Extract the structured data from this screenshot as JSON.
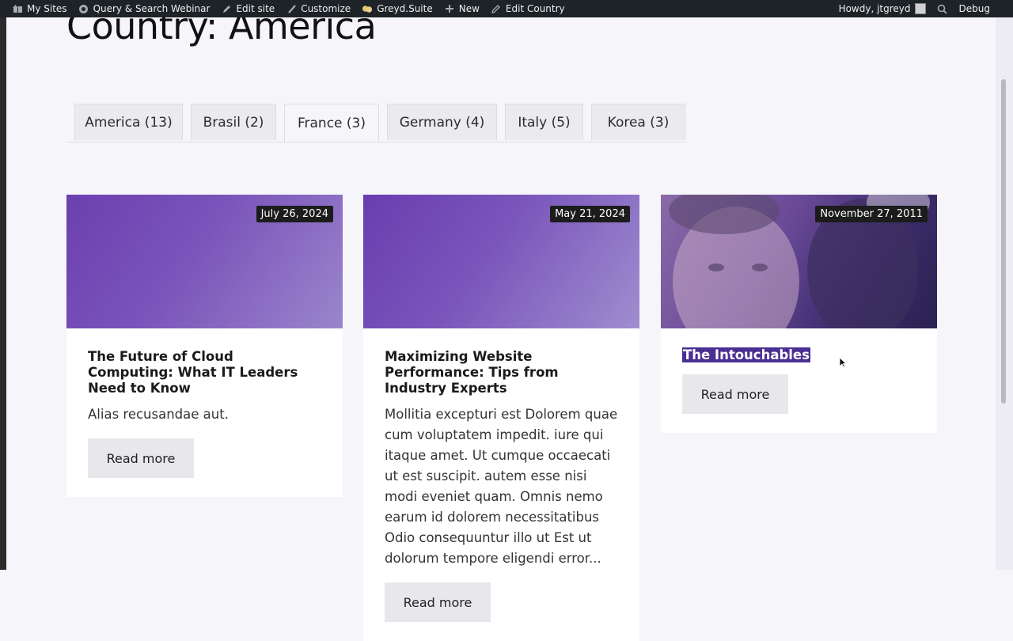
{
  "adminbar": {
    "left": [
      {
        "label": "My Sites",
        "icon": "my-sites-icon"
      },
      {
        "label": "Query & Search Webinar",
        "icon": "site-home-icon"
      },
      {
        "label": "Edit site",
        "icon": "edit-site-icon"
      },
      {
        "label": "Customize",
        "icon": "customize-brush-icon"
      },
      {
        "label": "Greyd.Suite",
        "icon": "greyd-icon"
      },
      {
        "label": "New",
        "icon": "plus-icon"
      },
      {
        "label": "Edit Country",
        "icon": "pencil-icon"
      }
    ],
    "howdy": "Howdy, jtgreyd",
    "debug": "Debug"
  },
  "page": {
    "title": "Country: America"
  },
  "tabs": [
    {
      "label": "America (13)"
    },
    {
      "label": "Brasil (2)"
    },
    {
      "label": "France (3)"
    },
    {
      "label": "Germany (4)"
    },
    {
      "label": "Italy (5)"
    },
    {
      "label": "Korea (3)"
    }
  ],
  "active_tab": "France (3)",
  "cards": [
    {
      "date": "July 26, 2024",
      "title": "The Future of Cloud Computing: What IT Leaders Need to Know",
      "excerpt": "Alias recusandae aut.",
      "button": "Read more"
    },
    {
      "date": "May 21, 2024",
      "title": "Maximizing Website Performance: Tips from Industry Experts",
      "excerpt": "Mollitia excepturi est Dolorem quae cum voluptatem impedit. iure qui itaque amet. Ut cumque occaecati ut est suscipit. autem esse nisi modi eveniet quam. Omnis nemo earum id dolorem necessitatibus Odio consequuntur illo ut Est ut dolorum tempore eligendi error...",
      "button": "Read more"
    },
    {
      "date": "November 27, 2011",
      "title": "The Intouchables",
      "excerpt": "",
      "button": "Read more"
    }
  ],
  "colors": {
    "accent_purple": "#6a4bb5",
    "highlight": "#4a2f93",
    "adminbar": "#1d2327"
  }
}
